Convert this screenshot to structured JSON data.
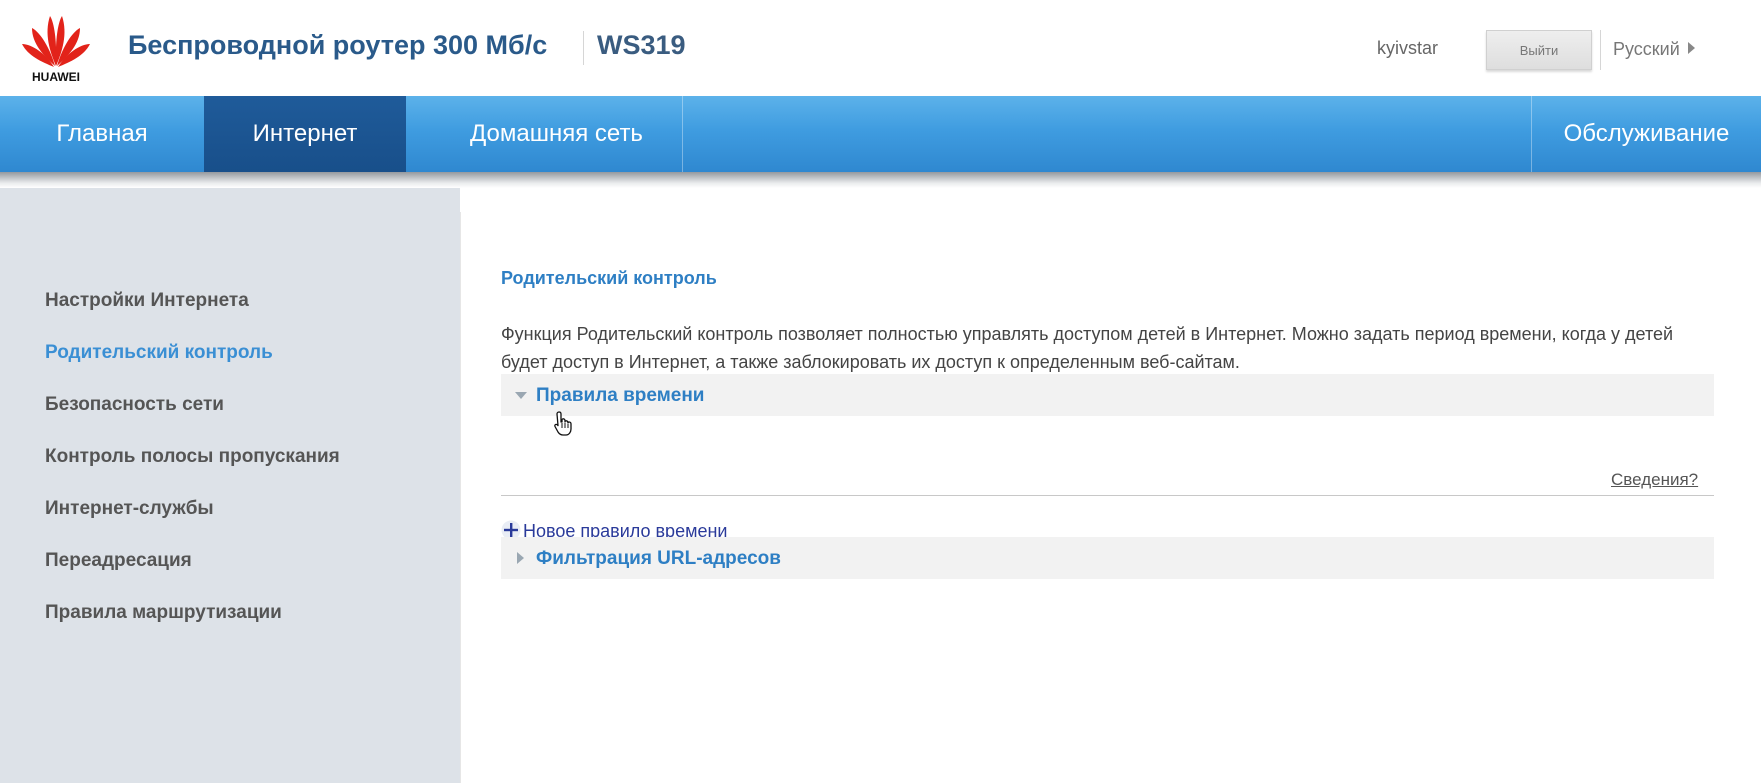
{
  "header": {
    "logo_text": "HUAWEI",
    "product_title": "Беспроводной роутер 300 Мб/с",
    "model": "WS319",
    "username": "kyivstar",
    "logout_label": "Выйти",
    "language": "Русский"
  },
  "nav": {
    "items": [
      {
        "label": "Главная",
        "active": false
      },
      {
        "label": "Интернет",
        "active": true
      },
      {
        "label": "Домашняя сеть",
        "active": false
      },
      {
        "label": "Обслуживание",
        "active": false
      }
    ]
  },
  "sidebar": {
    "items": [
      {
        "label": "Настройки Интернета",
        "active": false
      },
      {
        "label": "Родительский контроль",
        "active": true
      },
      {
        "label": "Безопасность сети",
        "active": false
      },
      {
        "label": "Контроль полосы пропускания",
        "active": false
      },
      {
        "label": "Интернет-службы",
        "active": false
      },
      {
        "label": "Переадресация",
        "active": false
      },
      {
        "label": "Правила маршрутизации",
        "active": false
      }
    ]
  },
  "main": {
    "title": "Родительский контроль",
    "description": "Функция Родительский контроль позволяет полностью управлять доступом детей в Интернет. Можно задать период времени, когда у детей будет доступ в Интернет, а также заблокировать их доступ к определенным веб-сайтам.",
    "time_rules": {
      "label": "Правила времени",
      "expanded": true
    },
    "details_link": "Сведения?",
    "add_rule_label": "Новое правило времени",
    "url_filter": {
      "label": "Фильтрация URL-адресов",
      "expanded": false
    }
  },
  "colors": {
    "nav_blue": "#3f9ce0",
    "nav_active": "#1f5b9a",
    "link_blue": "#2e7fc4",
    "brand_red": "#e2231a"
  }
}
